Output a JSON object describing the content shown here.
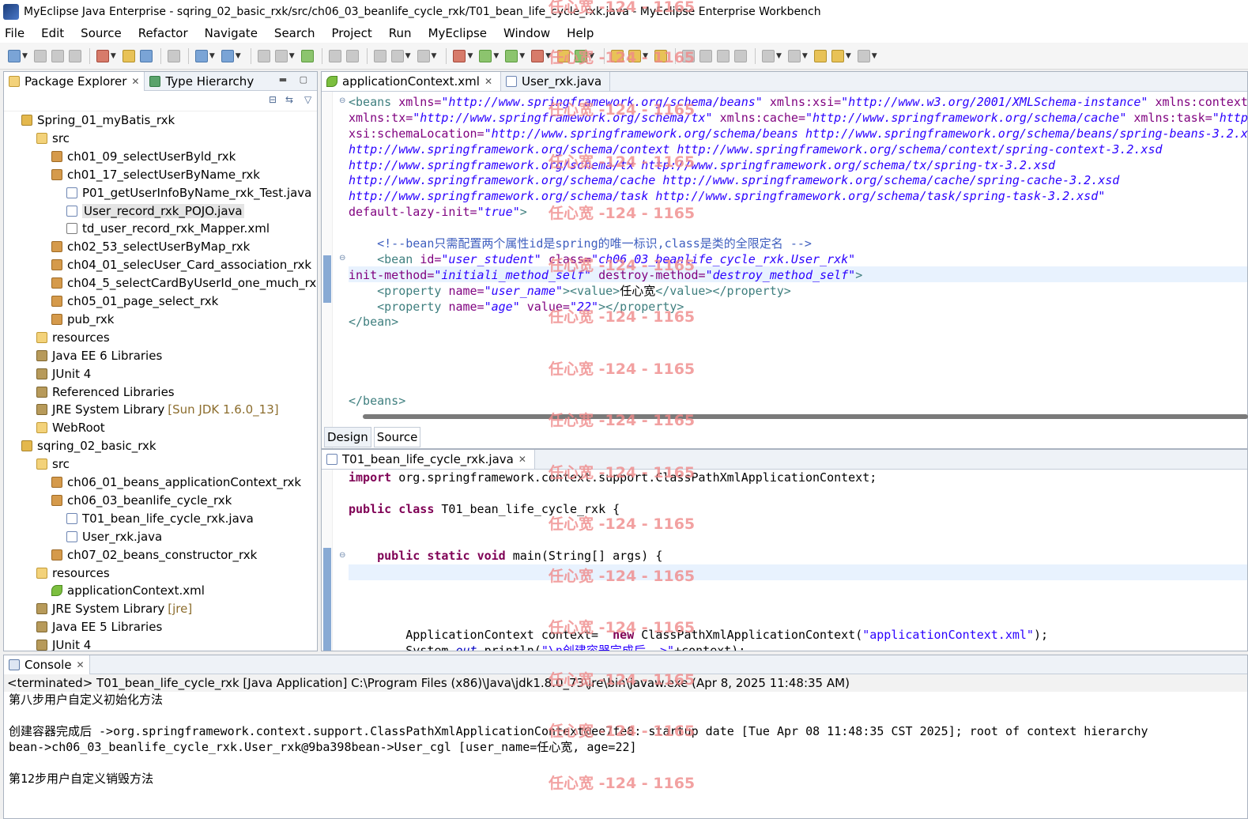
{
  "window": {
    "title": "MyEclipse Java Enterprise - sqring_02_basic_rxk/src/ch06_03_beanlife_cycle_rxk/T01_bean_life_cycle_rxk.java - MyEclipse Enterprise Workbench"
  },
  "menu": [
    "File",
    "Edit",
    "Source",
    "Refactor",
    "Navigate",
    "Search",
    "Project",
    "Run",
    "MyEclipse",
    "Window",
    "Help"
  ],
  "explorer": {
    "tabs": [
      "Package Explorer",
      "Type Hierarchy"
    ],
    "tree": [
      {
        "label": "Spring_01_myBatis_rxk",
        "icon": "project-icon",
        "depth": 0
      },
      {
        "label": "src",
        "icon": "source-folder-icon",
        "depth": 1
      },
      {
        "label": "ch01_09_selectUserByld_rxk",
        "icon": "package-icon",
        "depth": 2
      },
      {
        "label": "ch01_17_selectUserByName_rxk",
        "icon": "package-icon",
        "depth": 2
      },
      {
        "label": "P01_getUserInfoByName_rxk_Test.java",
        "icon": "java-file-icon",
        "depth": 3
      },
      {
        "label": "User_record_rxk_POJO.java",
        "icon": "java-file-icon",
        "depth": 3,
        "selected": true
      },
      {
        "label": "td_user_record_rxk_Mapper.xml",
        "icon": "xml-file-icon",
        "depth": 3
      },
      {
        "label": "ch02_53_selectUserByMap_rxk",
        "icon": "package-icon",
        "depth": 2
      },
      {
        "label": "ch04_01_selecUser_Card_association_rxk",
        "icon": "package-icon",
        "depth": 2
      },
      {
        "label": "ch04_5_selectCardByUserId_one_much_rxk",
        "icon": "package-icon",
        "depth": 2
      },
      {
        "label": "ch05_01_page_select_rxk",
        "icon": "package-icon",
        "depth": 2
      },
      {
        "label": "pub_rxk",
        "icon": "package-icon",
        "depth": 2
      },
      {
        "label": "resources",
        "icon": "source-folder-icon",
        "depth": 1
      },
      {
        "label": "Java EE 6 Libraries",
        "icon": "library-icon",
        "depth": 1
      },
      {
        "label": "JUnit 4",
        "icon": "library-icon",
        "depth": 1
      },
      {
        "label": "Referenced Libraries",
        "icon": "library-icon",
        "depth": 1
      },
      {
        "label": "JRE System Library",
        "suffix": "[Sun JDK 1.6.0_13]",
        "icon": "library-icon",
        "depth": 1
      },
      {
        "label": "WebRoot",
        "icon": "folder-icon",
        "depth": 1
      },
      {
        "label": "sqring_02_basic_rxk",
        "icon": "project-icon",
        "depth": 0
      },
      {
        "label": "src",
        "icon": "source-folder-icon",
        "depth": 1
      },
      {
        "label": "ch06_01_beans_applicationContext_rxk",
        "icon": "package-icon",
        "depth": 2
      },
      {
        "label": "ch06_03_beanlife_cycle_rxk",
        "icon": "package-icon",
        "depth": 2
      },
      {
        "label": "T01_bean_life_cycle_rxk.java",
        "icon": "java-file-icon",
        "depth": 3
      },
      {
        "label": "User_rxk.java",
        "icon": "java-file-icon",
        "depth": 3
      },
      {
        "label": "ch07_02_beans_constructor_rxk",
        "icon": "package-icon",
        "depth": 2
      },
      {
        "label": "resources",
        "icon": "source-folder-icon",
        "depth": 1
      },
      {
        "label": "applicationContext.xml",
        "icon": "spring-xml-icon",
        "depth": 2
      },
      {
        "label": "JRE System Library",
        "suffix": "[jre]",
        "icon": "library-icon",
        "depth": 1
      },
      {
        "label": "Java EE 5 Libraries",
        "icon": "library-icon",
        "depth": 1
      },
      {
        "label": "JUnit 4",
        "icon": "library-icon",
        "depth": 1
      }
    ]
  },
  "xml_editor": {
    "tabs": [
      "applicationContext.xml",
      "User_rxk.java"
    ],
    "lines": [
      [
        {
          "t": "<beans ",
          "c": "tag"
        },
        {
          "t": "xmlns=",
          "c": "attr"
        },
        {
          "t": "\"http://www.springframework.org/schema/beans\"",
          "c": "str"
        },
        {
          "t": " xmlns:xsi=",
          "c": "attr"
        },
        {
          "t": "\"http://www.w3.org/2001/XMLSchema-instance\"",
          "c": "str"
        },
        {
          "t": " xmlns:context=",
          "c": "attr"
        }
      ],
      [
        {
          "t": "xmlns:tx=",
          "c": "attr"
        },
        {
          "t": "\"http://www.springframework.org/schema/tx\"",
          "c": "str"
        },
        {
          "t": " xmlns:cache=",
          "c": "attr"
        },
        {
          "t": "\"http://www.springframework.org/schema/cache\"",
          "c": "str"
        },
        {
          "t": " xmlns:task=",
          "c": "attr"
        },
        {
          "t": "\"http",
          "c": "str"
        }
      ],
      [
        {
          "t": "xsi:schemaLocation=",
          "c": "attr"
        },
        {
          "t": "\"http://www.springframework.org/schema/beans http://www.springframework.org/schema/beans/spring-beans-3.2.x",
          "c": "str"
        }
      ],
      [
        {
          "t": "http://www.springframework.org/schema/context http://www.springframework.org/schema/context/spring-context-3.2.xsd",
          "c": "str"
        }
      ],
      [
        {
          "t": "http://www.springframework.org/schema/tx http://www.springframework.org/schema/tx/spring-tx-3.2.xsd",
          "c": "str"
        }
      ],
      [
        {
          "t": "http://www.springframework.org/schema/cache http://www.springframework.org/schema/cache/spring-cache-3.2.xsd",
          "c": "str"
        }
      ],
      [
        {
          "t": "http://www.springframework.org/schema/task http://www.springframework.org/schema/task/spring-task-3.2.xsd\"",
          "c": "str"
        }
      ],
      [
        {
          "t": "default-lazy-init=",
          "c": "attr"
        },
        {
          "t": "\"true\"",
          "c": "str"
        },
        {
          "t": ">",
          "c": "tag"
        }
      ],
      [],
      [
        {
          "t": "    <!--bean只需配置两个属性id是spring的唯一标识,class是类的全限定名 -->",
          "c": "com"
        }
      ],
      [
        {
          "t": "    <bean ",
          "c": "tag"
        },
        {
          "t": "id=",
          "c": "attr"
        },
        {
          "t": "\"user_student\"",
          "c": "str"
        },
        {
          "t": " class=",
          "c": "attr"
        },
        {
          "t": "\"ch06_03_beanlife_cycle_rxk.User_rxk\"",
          "c": "str"
        }
      ],
      [
        {
          "t": "init-method=",
          "c": "attr"
        },
        {
          "t": "\"initiali_method_self\"",
          "c": "str"
        },
        {
          "t": " destroy-method=",
          "c": "attr"
        },
        {
          "t": "\"destroy_method_self\"",
          "c": "str"
        },
        {
          "t": ">",
          "c": "tag"
        }
      ],
      [
        {
          "t": "    <property ",
          "c": "tag"
        },
        {
          "t": "name=",
          "c": "attr"
        },
        {
          "t": "\"user_name\"",
          "c": "str"
        },
        {
          "t": "><value>",
          "c": "tag"
        },
        {
          "t": "任心宽",
          "c": "txt"
        },
        {
          "t": "</value></property>",
          "c": "tag"
        }
      ],
      [
        {
          "t": "    <property ",
          "c": "tag"
        },
        {
          "t": "name=",
          "c": "attr"
        },
        {
          "t": "\"age\"",
          "c": "str"
        },
        {
          "t": " value=",
          "c": "attr"
        },
        {
          "t": "\"22\"",
          "c": "str"
        },
        {
          "t": "></property>",
          "c": "tag"
        }
      ],
      [
        {
          "t": "</bean>",
          "c": "tag"
        }
      ],
      [],
      [],
      [],
      [],
      [
        {
          "t": "</beans>",
          "c": "tag"
        }
      ]
    ],
    "bottom_tabs": [
      "Design",
      "Source"
    ]
  },
  "java_editor": {
    "tab": "T01_bean_life_cycle_rxk.java",
    "lines": [
      [
        {
          "t": "import",
          "c": "kw"
        },
        {
          "t": " org.springframework.context.support.ClassPathXmlApplicationContext;",
          "c": "txt"
        }
      ],
      [],
      [
        {
          "t": "public",
          "c": "kw"
        },
        {
          "t": " ",
          "c": "txt"
        },
        {
          "t": "class",
          "c": "kw"
        },
        {
          "t": " T01_bean_life_cycle_rxk {",
          "c": "txt"
        }
      ],
      [],
      [],
      [
        {
          "t": "    ",
          "c": "txt"
        },
        {
          "t": "public",
          "c": "kw"
        },
        {
          "t": " ",
          "c": "txt"
        },
        {
          "t": "static",
          "c": "kw"
        },
        {
          "t": " ",
          "c": "txt"
        },
        {
          "t": "void",
          "c": "kw"
        },
        {
          "t": " main(String[] args) {",
          "c": "txt"
        }
      ],
      [],
      [],
      [],
      [],
      [
        {
          "t": "        ApplicationContext context=  ",
          "c": "txt"
        },
        {
          "t": "new",
          "c": "kw"
        },
        {
          "t": " ClassPathXmlApplicationContext(",
          "c": "txt"
        },
        {
          "t": "\"applicationContext.xml\"",
          "c": "jstr"
        },
        {
          "t": ");",
          "c": "txt"
        }
      ],
      [
        {
          "t": "        System.",
          "c": "txt"
        },
        {
          "t": "out",
          "c": "fld"
        },
        {
          "t": ".println(",
          "c": "txt"
        },
        {
          "t": "\"\\n创建容器完成后 ->\"",
          "c": "jstr"
        },
        {
          "t": "+context);",
          "c": "txt"
        }
      ]
    ]
  },
  "console": {
    "tab": "Console",
    "status": "<terminated> T01_bean_life_cycle_rxk [Java Application] C:\\Program Files (x86)\\Java\\jdk1.8.0_73\\jre\\bin\\javaw.exe (Apr 8, 2025 11:48:35 AM)",
    "output": [
      "第八步用户自定义初始化方法",
      "",
      "创建容器完成后 ->org.springframework.context.support.ClassPathXmlApplicationContext@ee7fe8: startup date [Tue Apr 08 11:48:35 CST 2025]; root of context hierarchy",
      "bean->ch06_03_beanlife_cycle_rxk.User_rxk@9ba398bean->User_cgl [user_name=任心宽, age=22]",
      "",
      "第12步用户自定义销毁方法"
    ]
  },
  "watermark": "任心宽 -124 - 1165"
}
